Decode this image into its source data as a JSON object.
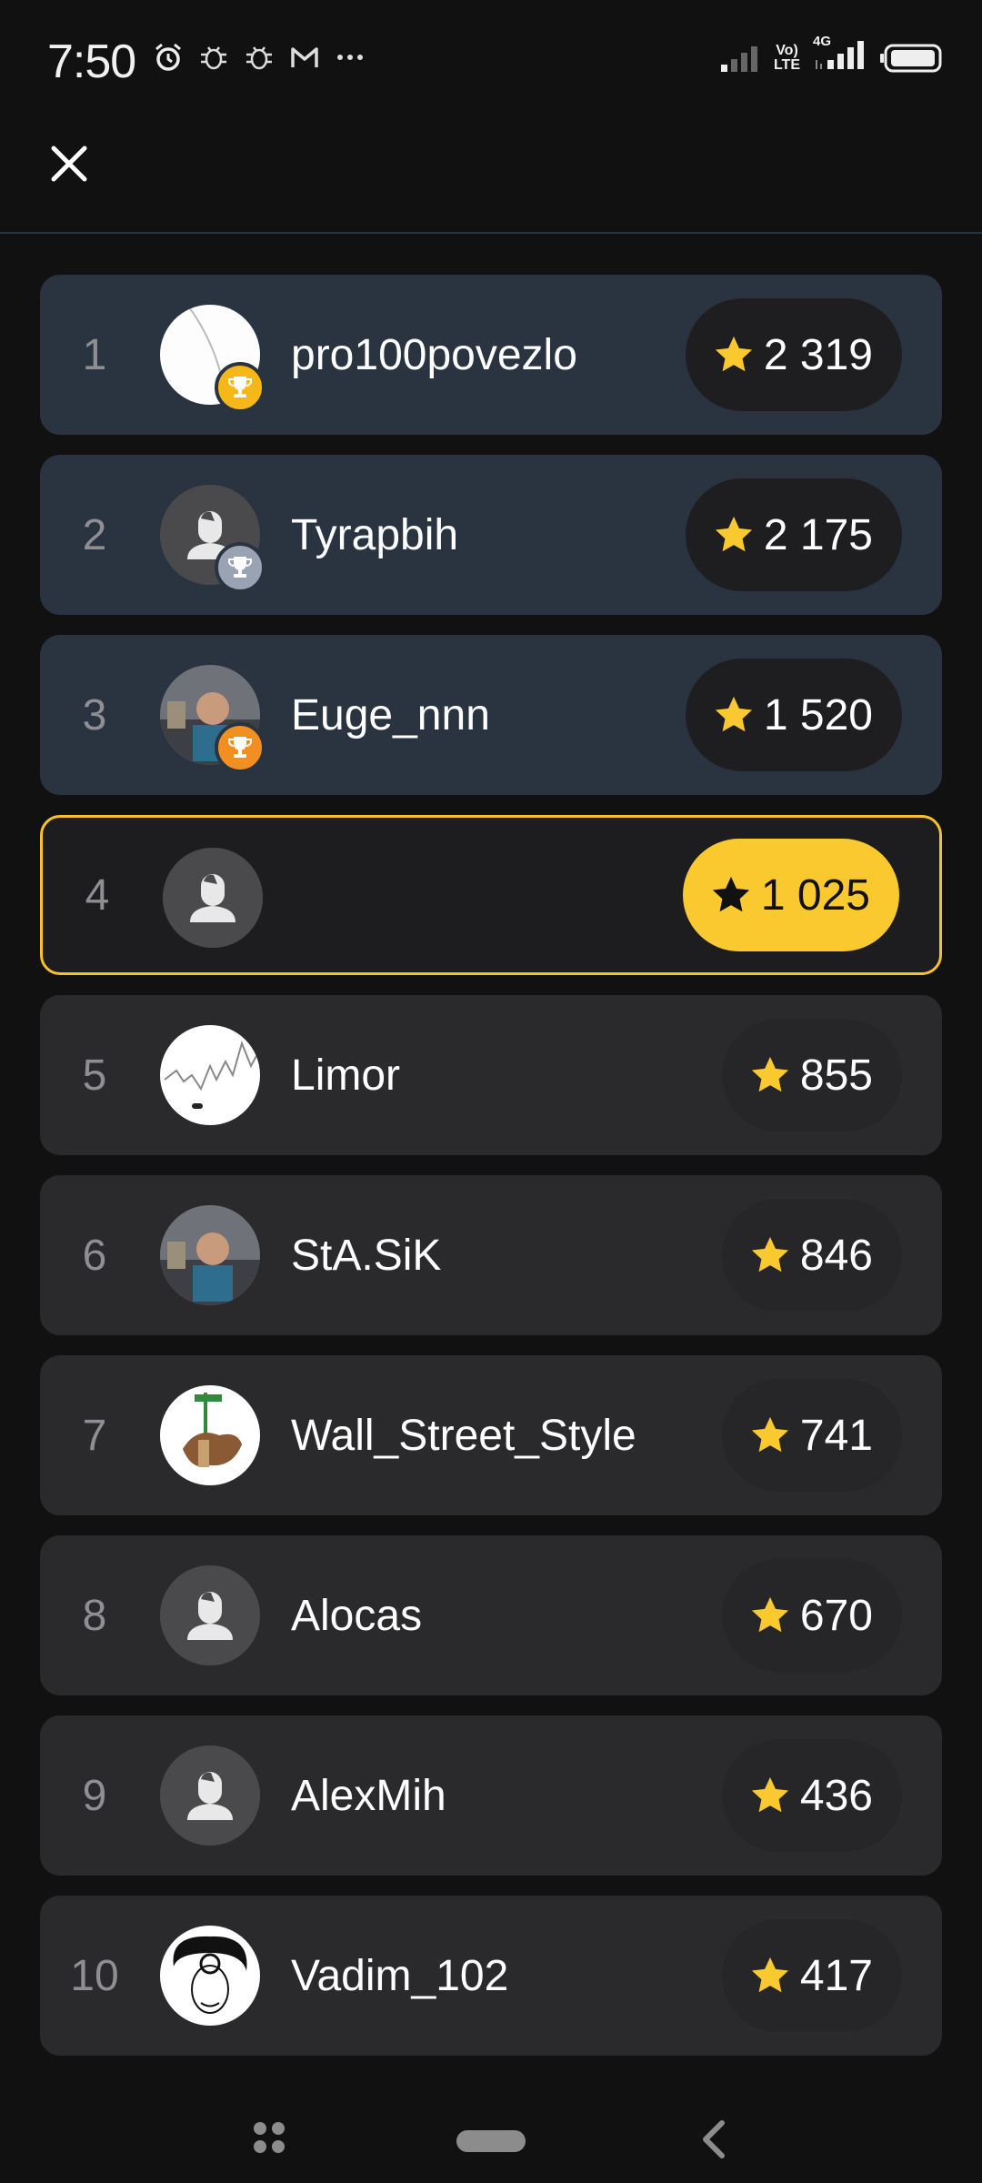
{
  "status_bar": {
    "time": "7:50",
    "left_icons": [
      "alarm-icon",
      "bug-icon",
      "bug-icon",
      "gmail-icon",
      "more-dots-icon"
    ],
    "network_label_top": "Vo)",
    "network_label_bottom": "LTE",
    "network_type": "4G",
    "battery_icon": "battery-icon"
  },
  "header": {
    "close_icon": "close-icon"
  },
  "leaderboard": {
    "accent_color": "#fac930",
    "rows": [
      {
        "rank": "1",
        "name": "pro100povezlo",
        "score": "2 319",
        "avatar": "white-avatar",
        "trophy": "gold"
      },
      {
        "rank": "2",
        "name": "Tyrapbih",
        "score": "2 175",
        "avatar": "default-avatar",
        "trophy": "silver"
      },
      {
        "rank": "3",
        "name": "Euge_nnn",
        "score": "1 520",
        "avatar": "photo-avatar",
        "trophy": "bronze"
      },
      {
        "rank": "4",
        "name": "",
        "score": "1 025",
        "avatar": "default-avatar",
        "trophy": "",
        "current_user": true
      },
      {
        "rank": "5",
        "name": "Limor",
        "score": "855",
        "avatar": "chart-avatar",
        "trophy": ""
      },
      {
        "rank": "6",
        "name": "StA.SiK",
        "score": "846",
        "avatar": "photo-avatar",
        "trophy": ""
      },
      {
        "rank": "7",
        "name": "Wall_Street_Style",
        "score": "741",
        "avatar": "bull-avatar",
        "trophy": ""
      },
      {
        "rank": "8",
        "name": "Alocas",
        "score": "670",
        "avatar": "default-avatar",
        "trophy": ""
      },
      {
        "rank": "9",
        "name": "AlexMih",
        "score": "436",
        "avatar": "default-avatar",
        "trophy": ""
      },
      {
        "rank": "10",
        "name": "Vadim_102",
        "score": "417",
        "avatar": "sketch-avatar",
        "trophy": ""
      }
    ]
  },
  "nav_bar": {
    "icons": [
      "apps-icon",
      "home-pill-icon",
      "back-icon"
    ]
  }
}
